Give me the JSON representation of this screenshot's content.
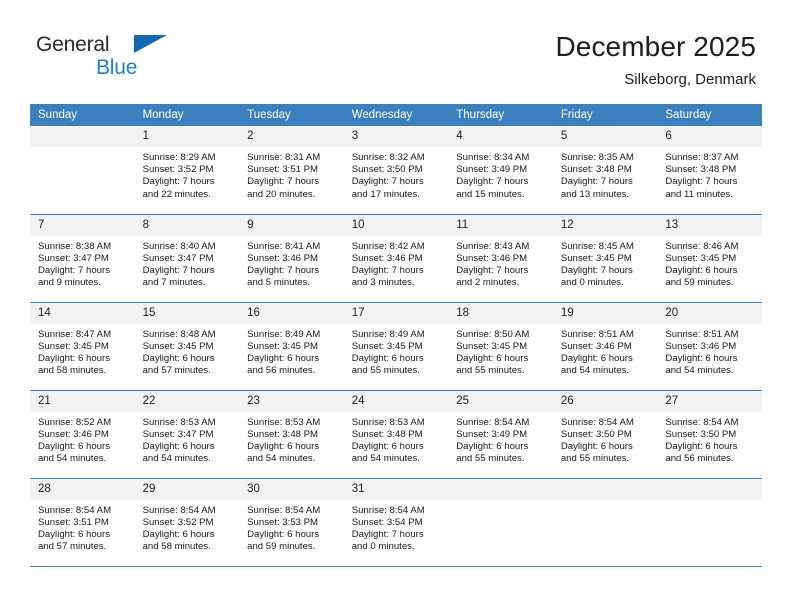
{
  "brand": {
    "line1": "General",
    "line2": "Blue",
    "accent_color": "#1268b3"
  },
  "header": {
    "title": "December 2025",
    "subtitle": "Silkeborg, Denmark"
  },
  "calendar": {
    "header_bg": "#3b7fbe",
    "daynum_bg": "#f2f2f2",
    "weekday_headers": [
      "Sunday",
      "Monday",
      "Tuesday",
      "Wednesday",
      "Thursday",
      "Friday",
      "Saturday"
    ],
    "weeks": [
      [
        {
          "day": "",
          "sunrise": "",
          "sunset": "",
          "daylight1": "",
          "daylight2": ""
        },
        {
          "day": "1",
          "sunrise": "Sunrise: 8:29 AM",
          "sunset": "Sunset: 3:52 PM",
          "daylight1": "Daylight: 7 hours",
          "daylight2": "and 22 minutes."
        },
        {
          "day": "2",
          "sunrise": "Sunrise: 8:31 AM",
          "sunset": "Sunset: 3:51 PM",
          "daylight1": "Daylight: 7 hours",
          "daylight2": "and 20 minutes."
        },
        {
          "day": "3",
          "sunrise": "Sunrise: 8:32 AM",
          "sunset": "Sunset: 3:50 PM",
          "daylight1": "Daylight: 7 hours",
          "daylight2": "and 17 minutes."
        },
        {
          "day": "4",
          "sunrise": "Sunrise: 8:34 AM",
          "sunset": "Sunset: 3:49 PM",
          "daylight1": "Daylight: 7 hours",
          "daylight2": "and 15 minutes."
        },
        {
          "day": "5",
          "sunrise": "Sunrise: 8:35 AM",
          "sunset": "Sunset: 3:48 PM",
          "daylight1": "Daylight: 7 hours",
          "daylight2": "and 13 minutes."
        },
        {
          "day": "6",
          "sunrise": "Sunrise: 8:37 AM",
          "sunset": "Sunset: 3:48 PM",
          "daylight1": "Daylight: 7 hours",
          "daylight2": "and 11 minutes."
        }
      ],
      [
        {
          "day": "7",
          "sunrise": "Sunrise: 8:38 AM",
          "sunset": "Sunset: 3:47 PM",
          "daylight1": "Daylight: 7 hours",
          "daylight2": "and 9 minutes."
        },
        {
          "day": "8",
          "sunrise": "Sunrise: 8:40 AM",
          "sunset": "Sunset: 3:47 PM",
          "daylight1": "Daylight: 7 hours",
          "daylight2": "and 7 minutes."
        },
        {
          "day": "9",
          "sunrise": "Sunrise: 8:41 AM",
          "sunset": "Sunset: 3:46 PM",
          "daylight1": "Daylight: 7 hours",
          "daylight2": "and 5 minutes."
        },
        {
          "day": "10",
          "sunrise": "Sunrise: 8:42 AM",
          "sunset": "Sunset: 3:46 PM",
          "daylight1": "Daylight: 7 hours",
          "daylight2": "and 3 minutes."
        },
        {
          "day": "11",
          "sunrise": "Sunrise: 8:43 AM",
          "sunset": "Sunset: 3:46 PM",
          "daylight1": "Daylight: 7 hours",
          "daylight2": "and 2 minutes."
        },
        {
          "day": "12",
          "sunrise": "Sunrise: 8:45 AM",
          "sunset": "Sunset: 3:45 PM",
          "daylight1": "Daylight: 7 hours",
          "daylight2": "and 0 minutes."
        },
        {
          "day": "13",
          "sunrise": "Sunrise: 8:46 AM",
          "sunset": "Sunset: 3:45 PM",
          "daylight1": "Daylight: 6 hours",
          "daylight2": "and 59 minutes."
        }
      ],
      [
        {
          "day": "14",
          "sunrise": "Sunrise: 8:47 AM",
          "sunset": "Sunset: 3:45 PM",
          "daylight1": "Daylight: 6 hours",
          "daylight2": "and 58 minutes."
        },
        {
          "day": "15",
          "sunrise": "Sunrise: 8:48 AM",
          "sunset": "Sunset: 3:45 PM",
          "daylight1": "Daylight: 6 hours",
          "daylight2": "and 57 minutes."
        },
        {
          "day": "16",
          "sunrise": "Sunrise: 8:49 AM",
          "sunset": "Sunset: 3:45 PM",
          "daylight1": "Daylight: 6 hours",
          "daylight2": "and 56 minutes."
        },
        {
          "day": "17",
          "sunrise": "Sunrise: 8:49 AM",
          "sunset": "Sunset: 3:45 PM",
          "daylight1": "Daylight: 6 hours",
          "daylight2": "and 55 minutes."
        },
        {
          "day": "18",
          "sunrise": "Sunrise: 8:50 AM",
          "sunset": "Sunset: 3:45 PM",
          "daylight1": "Daylight: 6 hours",
          "daylight2": "and 55 minutes."
        },
        {
          "day": "19",
          "sunrise": "Sunrise: 8:51 AM",
          "sunset": "Sunset: 3:46 PM",
          "daylight1": "Daylight: 6 hours",
          "daylight2": "and 54 minutes."
        },
        {
          "day": "20",
          "sunrise": "Sunrise: 8:51 AM",
          "sunset": "Sunset: 3:46 PM",
          "daylight1": "Daylight: 6 hours",
          "daylight2": "and 54 minutes."
        }
      ],
      [
        {
          "day": "21",
          "sunrise": "Sunrise: 8:52 AM",
          "sunset": "Sunset: 3:46 PM",
          "daylight1": "Daylight: 6 hours",
          "daylight2": "and 54 minutes."
        },
        {
          "day": "22",
          "sunrise": "Sunrise: 8:53 AM",
          "sunset": "Sunset: 3:47 PM",
          "daylight1": "Daylight: 6 hours",
          "daylight2": "and 54 minutes."
        },
        {
          "day": "23",
          "sunrise": "Sunrise: 8:53 AM",
          "sunset": "Sunset: 3:48 PM",
          "daylight1": "Daylight: 6 hours",
          "daylight2": "and 54 minutes."
        },
        {
          "day": "24",
          "sunrise": "Sunrise: 8:53 AM",
          "sunset": "Sunset: 3:48 PM",
          "daylight1": "Daylight: 6 hours",
          "daylight2": "and 54 minutes."
        },
        {
          "day": "25",
          "sunrise": "Sunrise: 8:54 AM",
          "sunset": "Sunset: 3:49 PM",
          "daylight1": "Daylight: 6 hours",
          "daylight2": "and 55 minutes."
        },
        {
          "day": "26",
          "sunrise": "Sunrise: 8:54 AM",
          "sunset": "Sunset: 3:50 PM",
          "daylight1": "Daylight: 6 hours",
          "daylight2": "and 55 minutes."
        },
        {
          "day": "27",
          "sunrise": "Sunrise: 8:54 AM",
          "sunset": "Sunset: 3:50 PM",
          "daylight1": "Daylight: 6 hours",
          "daylight2": "and 56 minutes."
        }
      ],
      [
        {
          "day": "28",
          "sunrise": "Sunrise: 8:54 AM",
          "sunset": "Sunset: 3:51 PM",
          "daylight1": "Daylight: 6 hours",
          "daylight2": "and 57 minutes."
        },
        {
          "day": "29",
          "sunrise": "Sunrise: 8:54 AM",
          "sunset": "Sunset: 3:52 PM",
          "daylight1": "Daylight: 6 hours",
          "daylight2": "and 58 minutes."
        },
        {
          "day": "30",
          "sunrise": "Sunrise: 8:54 AM",
          "sunset": "Sunset: 3:53 PM",
          "daylight1": "Daylight: 6 hours",
          "daylight2": "and 59 minutes."
        },
        {
          "day": "31",
          "sunrise": "Sunrise: 8:54 AM",
          "sunset": "Sunset: 3:54 PM",
          "daylight1": "Daylight: 7 hours",
          "daylight2": "and 0 minutes."
        },
        {
          "day": "",
          "sunrise": "",
          "sunset": "",
          "daylight1": "",
          "daylight2": ""
        },
        {
          "day": "",
          "sunrise": "",
          "sunset": "",
          "daylight1": "",
          "daylight2": ""
        },
        {
          "day": "",
          "sunrise": "",
          "sunset": "",
          "daylight1": "",
          "daylight2": ""
        }
      ]
    ]
  }
}
